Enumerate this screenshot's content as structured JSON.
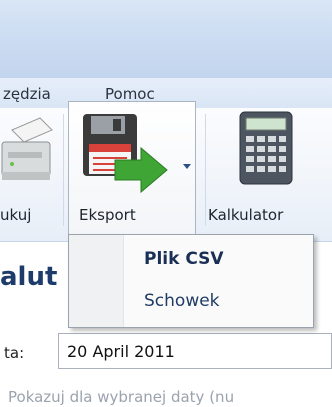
{
  "menu": {
    "items": [
      {
        "label": "zędzia"
      },
      {
        "label": "Pomoc"
      }
    ]
  },
  "ribbon": {
    "buttons": [
      {
        "label": "ukuj",
        "icon": "printer-icon"
      },
      {
        "label": "Eksport",
        "icon": "floppy-export-icon",
        "has_dropdown": true
      },
      {
        "label": "Kalkulator",
        "icon": "calculator-icon"
      }
    ]
  },
  "dropdown": {
    "items": [
      {
        "label": "Plik CSV"
      },
      {
        "label": "Schowek"
      }
    ]
  },
  "content": {
    "title": "alut",
    "date_label": "ta:",
    "date_value": "20 April 2011",
    "hint": "Pokazuj dla wybranej daty (nu"
  },
  "colors": {
    "accent_green": "#3fa535",
    "title_blue": "#1d3c6b",
    "ribbon_border": "#c8d6ea"
  }
}
